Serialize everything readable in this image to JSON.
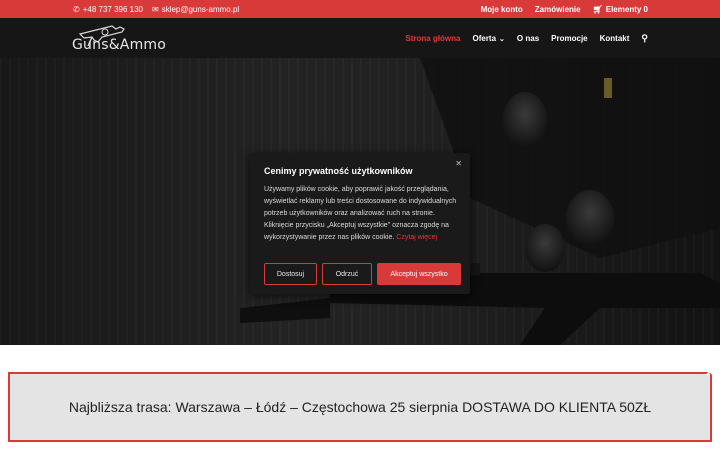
{
  "topbar": {
    "phone": "+48 737 396 130",
    "email": "sklep@guns-ammo.pl",
    "account": "Moje konto",
    "orders": "Zamówienie",
    "cart": "Elementy 0"
  },
  "header": {
    "logo_text": "Guns&Ammo",
    "nav": {
      "home": "Strona główna",
      "offer": "Oferta",
      "about": "O nas",
      "promo": "Promocje",
      "contact": "Kontakt"
    }
  },
  "cookie": {
    "title": "Cenimy prywatność użytkowników",
    "body": "Używamy plików cookie, aby poprawić jakość przeglądania, wyświetlać reklamy lub treści dostosowane do indywidualnych potrzeb użytkowników oraz analizować ruch na stronie. Kliknięcie przycisku „Akceptuj wszystkie\" oznacza zgodę na wykorzystywanie przez nas plików cookie.",
    "read_more": "Czytaj więcej",
    "customize": "Dostosuj",
    "reject": "Odrzuć",
    "accept": "Akceptuj wszystko"
  },
  "notice": {
    "text": "Najbliższa trasa: Warszawa – Łódź – Częstochowa 25 sierpnia DOSTAWA DO KLIENTA 50ZŁ"
  },
  "colors": {
    "accent": "#d83a3a",
    "header_bg": "#161616"
  }
}
